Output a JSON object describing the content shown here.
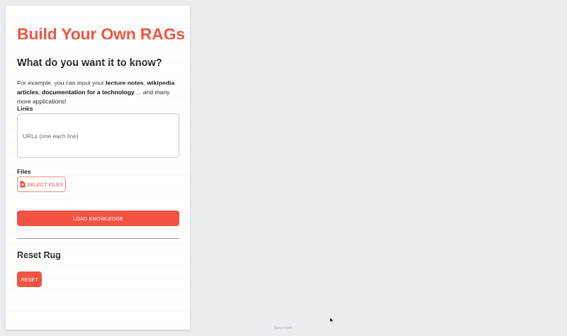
{
  "sidebar": {
    "title": "Build Your Own RAGs",
    "subtitle": "What do you want it to know?",
    "description": {
      "part1": "For example, you can input your ",
      "bold1": "lecture notes",
      "part2": ", ",
      "bold2": "wikipedia articles",
      "part3": ", ",
      "bold3": "documentation for a technology",
      "part4": " ... and many more applications!"
    },
    "links": {
      "label": "Links",
      "placeholder": "URLs (one each line)"
    },
    "files": {
      "label": "Files",
      "button_label": "SELECT FILES",
      "icon": "file-upload-icon"
    },
    "load_button_label": "LOAD KNOWLEDGE",
    "reset": {
      "heading": "Reset Rug",
      "button_label": "RESET"
    }
  },
  "footer": {
    "text": "Taipy inside"
  },
  "colors": {
    "accent": "#f25443",
    "title": "#ef5743",
    "background": "#ebeef1",
    "panel": "#ffffff"
  }
}
